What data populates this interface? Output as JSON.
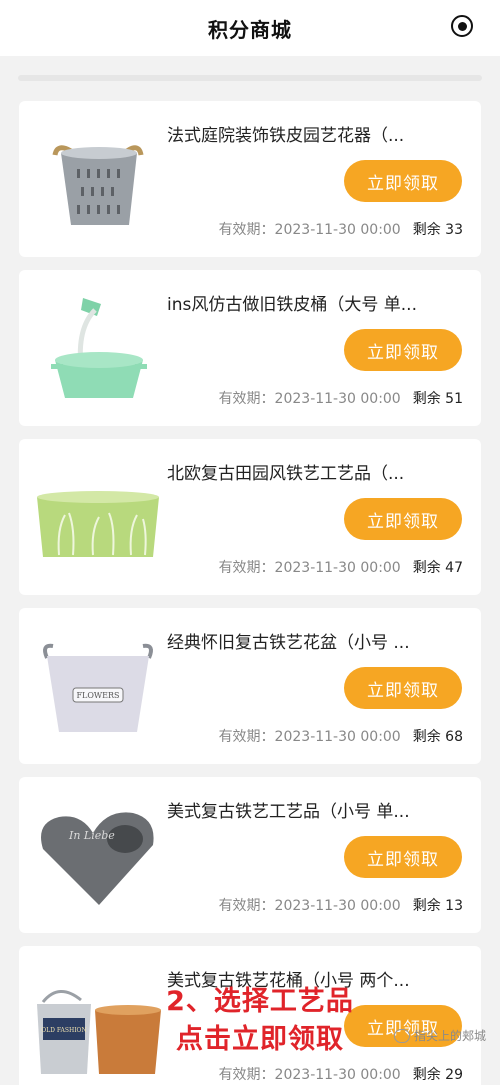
{
  "header": {
    "title": "积分商城",
    "menu_icon": "record-icon"
  },
  "products": [
    {
      "title": "法式庭院装饰铁皮园艺花器（...",
      "button": "立即领取",
      "validity": "有效期：2023-11-30 00:00",
      "stock": "剩余 33",
      "image": "galvanized-bucket-icon"
    },
    {
      "title": "ins风仿古做旧铁皮桶（大号 单...",
      "button": "立即领取",
      "validity": "有效期：2023-11-30 00:00",
      "stock": "剩余 51",
      "image": "watering-can-bucket-icon"
    },
    {
      "title": "北欧复古田园风铁艺工艺品（...",
      "button": "立即领取",
      "validity": "有效期：2023-11-30 00:00",
      "stock": "剩余 47",
      "image": "green-planter-icon"
    },
    {
      "title": "经典怀旧复古铁艺花盆（小号 ...",
      "button": "立即领取",
      "validity": "有效期：2023-11-30 00:00",
      "stock": "剩余 68",
      "image": "flowers-pot-icon"
    },
    {
      "title": "美式复古铁艺工艺品（小号 单...",
      "button": "立即领取",
      "validity": "有效期：2023-11-30 00:00",
      "stock": "剩余 13",
      "image": "heart-planter-icon"
    },
    {
      "title": "美式复古铁艺花桶（小号 两个...",
      "button": "立即领取",
      "validity": "有效期：2023-11-30 00:00",
      "stock": "剩余 29",
      "image": "vintage-buckets-icon"
    }
  ],
  "overlay": {
    "line1": "2、选择工艺品",
    "line2": "点击立即领取"
  },
  "watermark": {
    "text": "指尖上的郏城"
  },
  "colors": {
    "accent": "#f6a623",
    "overlay_text": "#e0242a"
  }
}
